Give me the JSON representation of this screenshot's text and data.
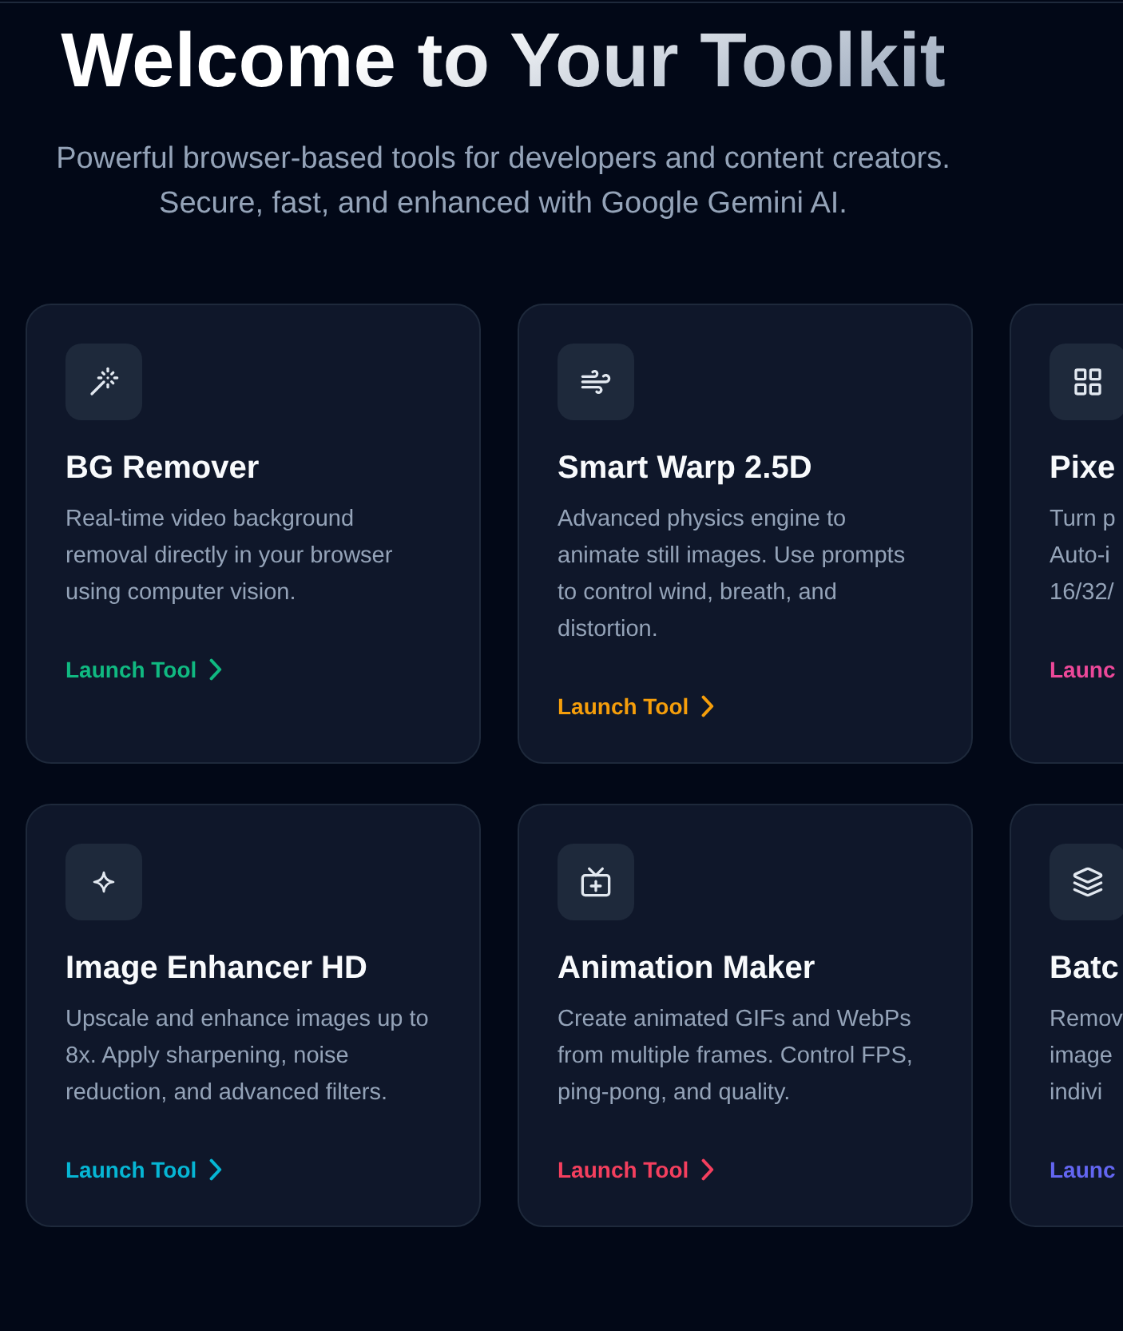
{
  "header": {
    "title": "Welcome to Your Toolkit",
    "subtitle": "Powerful browser-based tools for developers and content creators. Secure, fast, and enhanced with Google Gemini AI."
  },
  "tools": [
    {
      "title": "BG Remover",
      "description": "Real-time video background removal directly in your browser using computer vision.",
      "link": "Launch Tool",
      "color": "#10b981",
      "cut_off": false
    },
    {
      "title": "Smart Warp 2.5D",
      "description": "Advanced physics engine to animate still images. Use prompts to control wind, breath, and distortion.",
      "link": "Launch Tool",
      "color": "#f59e0b",
      "cut_off": false
    },
    {
      "title": "Pixe",
      "description": "Turn p\nAuto-i\n16/32/",
      "link": "Launc",
      "color": "#ec4899",
      "cut_off": true
    },
    {
      "title": "Image Enhancer HD",
      "description": "Upscale and enhance images up to 8x. Apply sharpening, noise reduction, and advanced filters.",
      "link": "Launch Tool",
      "color": "#06b6d4",
      "cut_off": false
    },
    {
      "title": "Animation Maker",
      "description": "Create animated GIFs and WebPs from multiple frames. Control FPS, ping-pong, and quality.",
      "link": "Launch Tool",
      "color": "#f43f5e",
      "cut_off": false
    },
    {
      "title": "Batc",
      "description": "Remov\nimage\nindivi",
      "link": "Launc",
      "color": "#6366f1",
      "cut_off": true
    }
  ]
}
